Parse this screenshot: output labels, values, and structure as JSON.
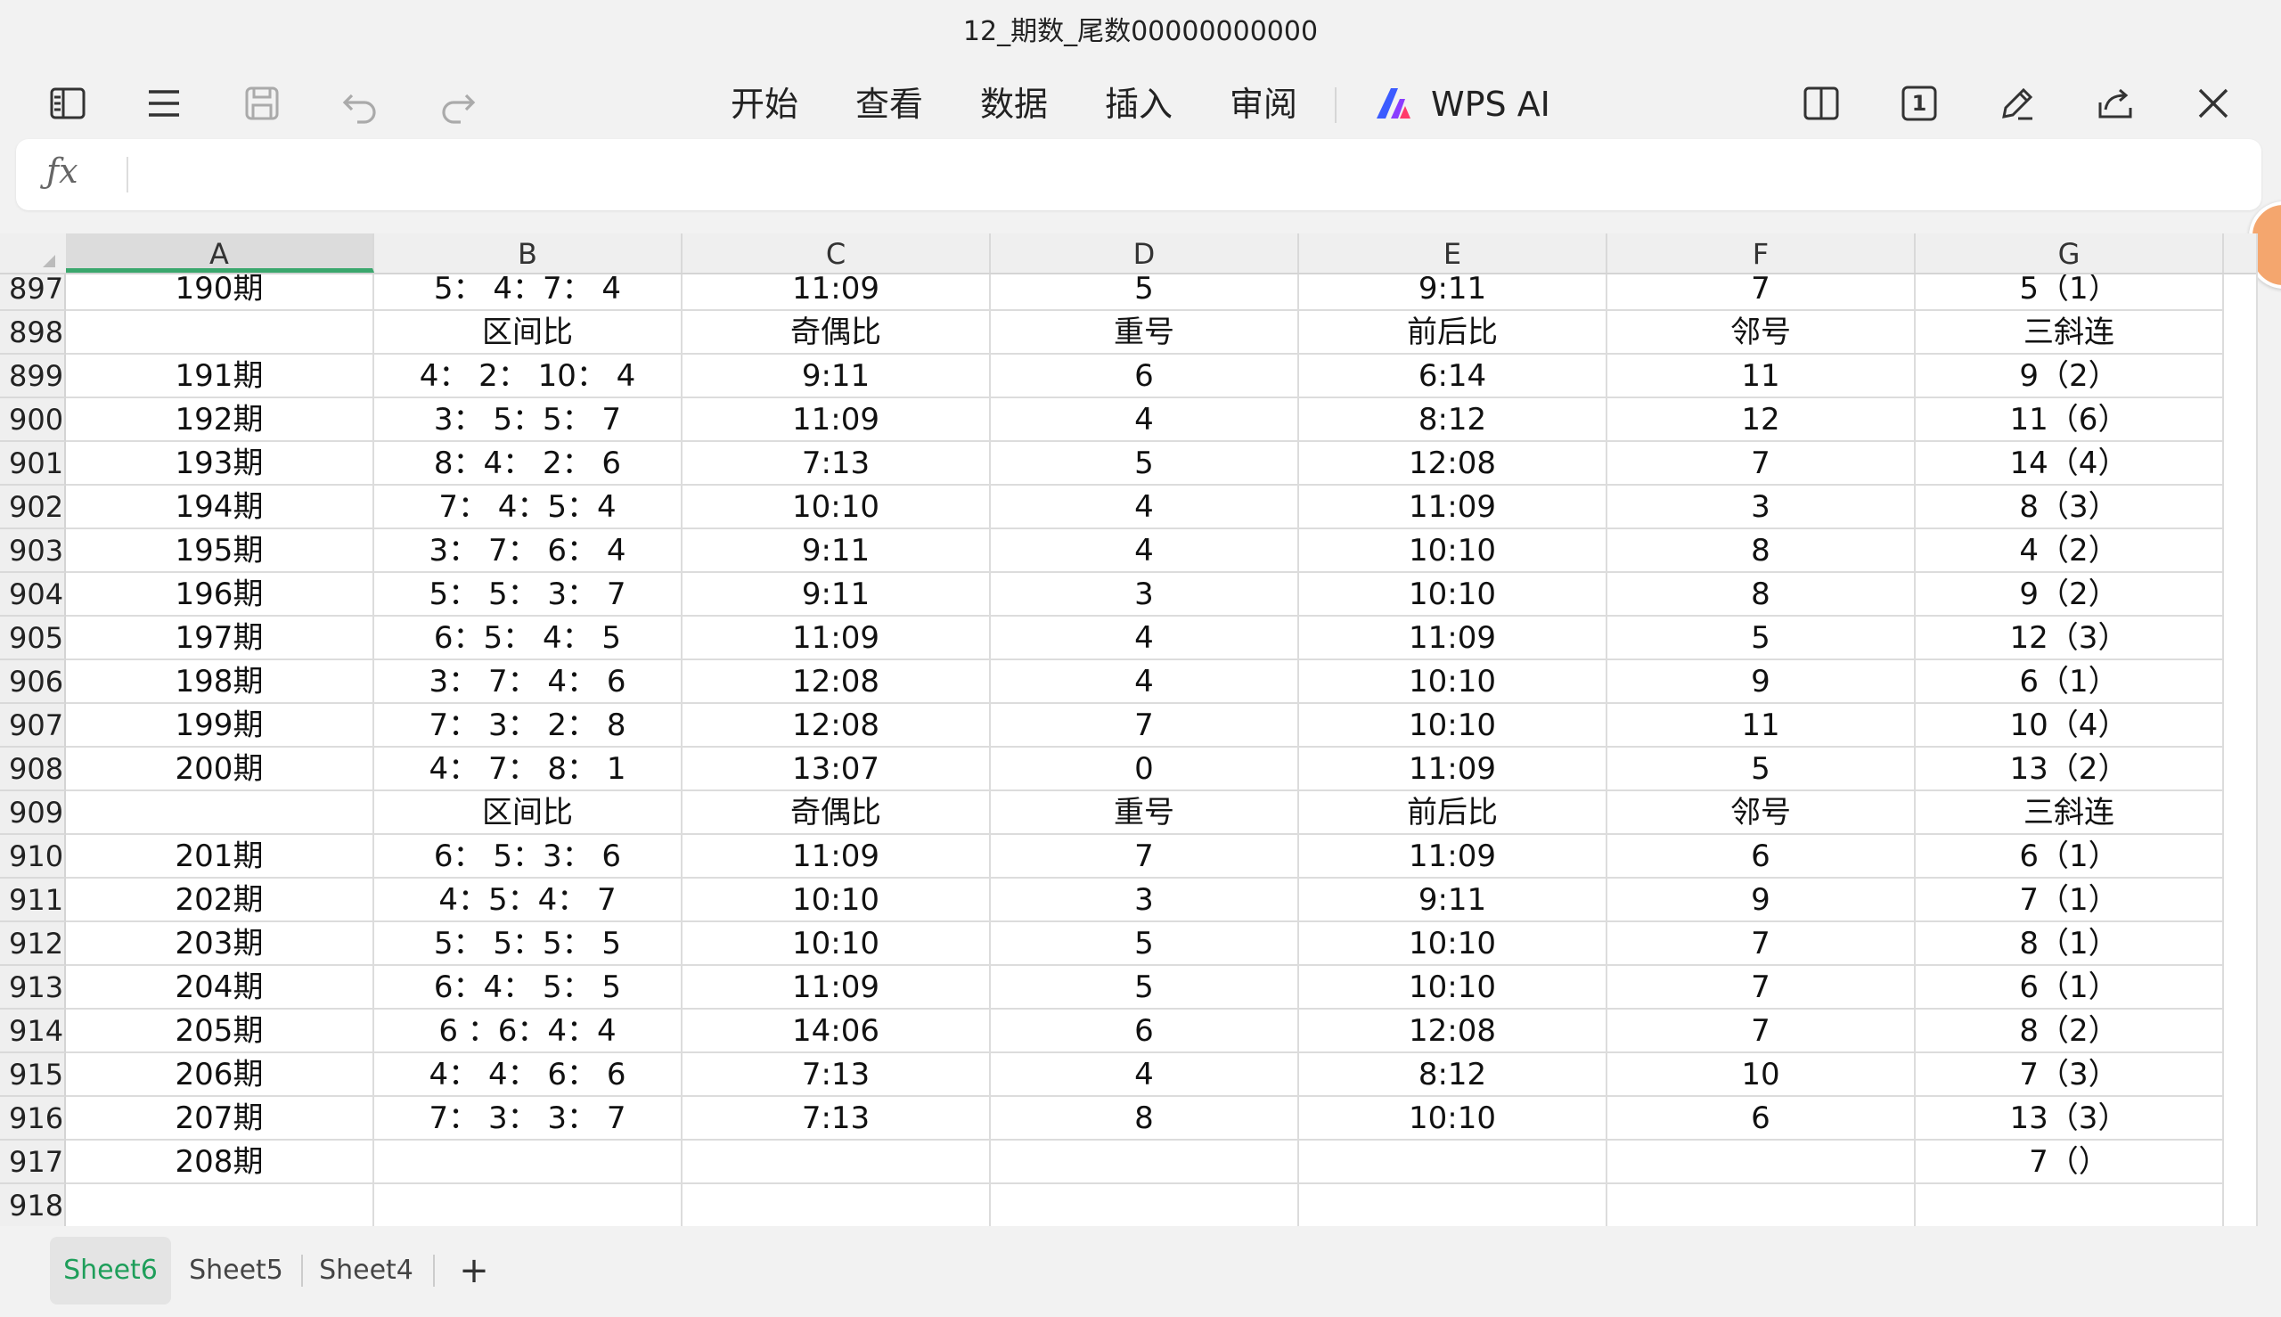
{
  "window": {
    "title": "12_期数_尾数00000000000"
  },
  "menu": [
    "开始",
    "查看",
    "数据",
    "插入",
    "审阅"
  ],
  "ai_label": "WPS AI",
  "page_badge": "1",
  "formula_bar": {
    "fx_label": "ƒx",
    "value": ""
  },
  "columns": [
    "A",
    "B",
    "C",
    "D",
    "E",
    "F",
    "G"
  ],
  "rows": [
    {
      "n": "897",
      "cells": [
        "190期",
        "5： 4：7： 4",
        "11:09",
        "5",
        "9:11",
        "7",
        "5（1）"
      ]
    },
    {
      "n": "898",
      "cells": [
        "",
        "区间比",
        "奇偶比",
        "重号",
        "前后比",
        "邻号",
        "三斜连"
      ]
    },
    {
      "n": "899",
      "cells": [
        "191期",
        "4： 2： 10： 4",
        "9:11",
        "6",
        "6:14",
        "11",
        "9（2）"
      ]
    },
    {
      "n": "900",
      "cells": [
        "192期",
        "3： 5：5： 7",
        "11:09",
        "4",
        "8:12",
        "12",
        "11（6）"
      ]
    },
    {
      "n": "901",
      "cells": [
        "193期",
        "8：4： 2： 6",
        "7:13",
        "5",
        "12:08",
        "7",
        "14（4）"
      ]
    },
    {
      "n": "902",
      "cells": [
        "194期",
        "7： 4：5：4",
        "10:10",
        "4",
        "11:09",
        "3",
        "8（3）"
      ]
    },
    {
      "n": "903",
      "cells": [
        "195期",
        "3： 7： 6： 4",
        "9:11",
        "4",
        "10:10",
        "8",
        "4（2）"
      ]
    },
    {
      "n": "904",
      "cells": [
        "196期",
        "5： 5： 3： 7",
        "9:11",
        "3",
        "10:10",
        "8",
        "9（2）"
      ]
    },
    {
      "n": "905",
      "cells": [
        "197期",
        "6：5： 4： 5",
        "11:09",
        "4",
        "11:09",
        "5",
        "12（3）"
      ]
    },
    {
      "n": "906",
      "cells": [
        "198期",
        "3： 7： 4： 6",
        "12:08",
        "4",
        "10:10",
        "9",
        "6（1）"
      ]
    },
    {
      "n": "907",
      "cells": [
        "199期",
        "7： 3： 2： 8",
        "12:08",
        "7",
        "10:10",
        "11",
        "10（4）"
      ]
    },
    {
      "n": "908",
      "cells": [
        "200期",
        "4： 7： 8： 1",
        "13:07",
        "0",
        "11:09",
        "5",
        "13（2）"
      ]
    },
    {
      "n": "909",
      "cells": [
        "",
        "区间比",
        "奇偶比",
        "重号",
        "前后比",
        "邻号",
        "三斜连"
      ]
    },
    {
      "n": "910",
      "cells": [
        "201期",
        "6： 5：3： 6",
        "11:09",
        "7",
        "11:09",
        "6",
        "6（1）"
      ]
    },
    {
      "n": "911",
      "cells": [
        "202期",
        "4：5：4： 7",
        "10:10",
        "3",
        "9:11",
        "9",
        "7（1）"
      ]
    },
    {
      "n": "912",
      "cells": [
        "203期",
        "5： 5：5： 5",
        "10:10",
        "5",
        "10:10",
        "7",
        "8（1）"
      ]
    },
    {
      "n": "913",
      "cells": [
        "204期",
        "6：4： 5： 5",
        "11:09",
        "5",
        "10:10",
        "7",
        "6（1）"
      ]
    },
    {
      "n": "914",
      "cells": [
        "205期",
        "6 ：6：4：4",
        "14:06",
        "6",
        "12:08",
        "7",
        "8（2）"
      ]
    },
    {
      "n": "915",
      "cells": [
        "206期",
        "4： 4： 6： 6",
        "7:13",
        "4",
        "8:12",
        "10",
        "7（3）"
      ]
    },
    {
      "n": "916",
      "cells": [
        "207期",
        "7： 3： 3： 7",
        "7:13",
        "8",
        "10:10",
        "6",
        "13（3）"
      ]
    },
    {
      "n": "917",
      "cells": [
        "208期",
        "",
        "",
        "",
        "",
        "",
        "7（）"
      ]
    },
    {
      "n": "918",
      "cells": [
        "",
        "",
        "",
        "",
        "",
        "",
        ""
      ]
    }
  ],
  "sheets": [
    "Sheet6",
    "Sheet5",
    "Sheet4"
  ],
  "add_sheet_label": "+",
  "colors": {
    "accent": "#1e9e5a",
    "selected_col_underline": "#3aa76d"
  }
}
